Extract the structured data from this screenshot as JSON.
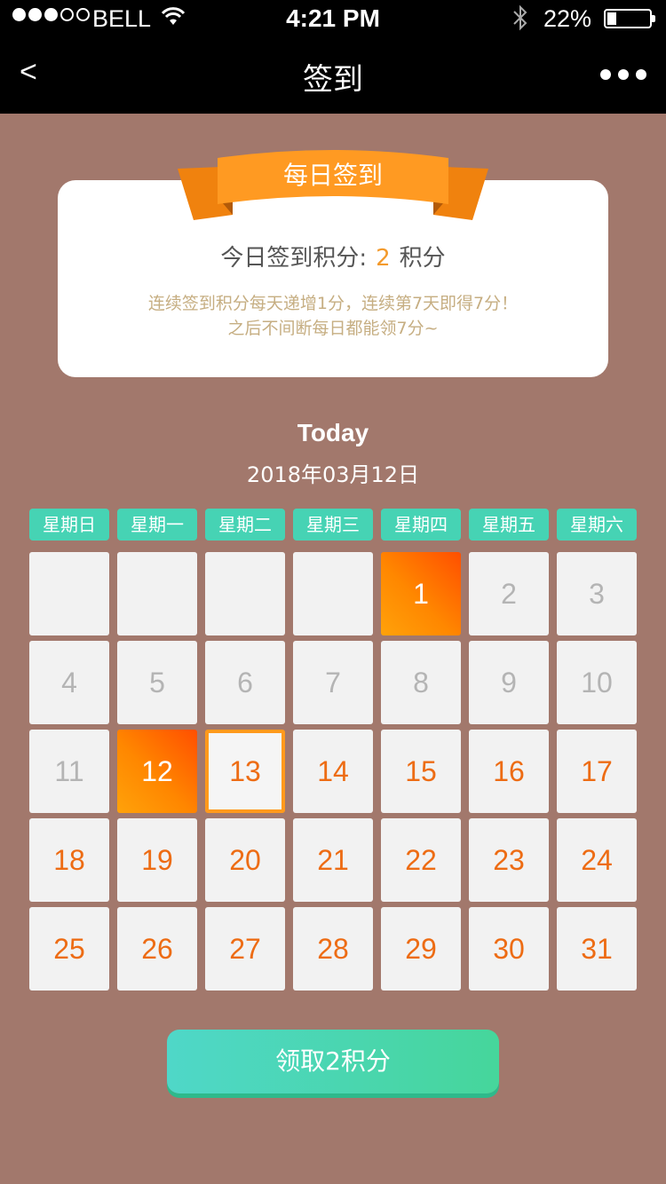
{
  "status_bar": {
    "carrier": "BELL",
    "time": "4:21 PM",
    "battery_percent": "22%",
    "battery_level": 0.22,
    "signal_bars_filled": 3,
    "signal_bars_total": 5
  },
  "nav": {
    "back_label": "<",
    "title": "签到"
  },
  "card": {
    "ribbon_label": "每日签到",
    "points_prefix": "今日签到积分:",
    "points_value": "2",
    "points_suffix": "积分",
    "desc_line1": "连续签到积分每天递增1分，连续第7天即得7分！",
    "desc_line2": "之后不间断每日都能领7分~"
  },
  "today_heading": "Today",
  "date": "2018年03月12日",
  "weekdays": [
    "星期日",
    "星期一",
    "星期二",
    "星期三",
    "星期四",
    "星期五",
    "星期六"
  ],
  "calendar": {
    "leading_blanks": 4,
    "days": [
      {
        "label": "1",
        "state": "signed"
      },
      {
        "label": "2",
        "state": "past"
      },
      {
        "label": "3",
        "state": "past"
      },
      {
        "label": "4",
        "state": "past"
      },
      {
        "label": "5",
        "state": "past"
      },
      {
        "label": "6",
        "state": "past"
      },
      {
        "label": "7",
        "state": "past"
      },
      {
        "label": "8",
        "state": "past"
      },
      {
        "label": "9",
        "state": "past"
      },
      {
        "label": "10",
        "state": "past"
      },
      {
        "label": "11",
        "state": "past"
      },
      {
        "label": "12",
        "state": "signed"
      },
      {
        "label": "13",
        "state": "today"
      },
      {
        "label": "14",
        "state": "future"
      },
      {
        "label": "15",
        "state": "future"
      },
      {
        "label": "16",
        "state": "future"
      },
      {
        "label": "17",
        "state": "future"
      },
      {
        "label": "18",
        "state": "future"
      },
      {
        "label": "19",
        "state": "future"
      },
      {
        "label": "20",
        "state": "future"
      },
      {
        "label": "21",
        "state": "future"
      },
      {
        "label": "22",
        "state": "future"
      },
      {
        "label": "23",
        "state": "future"
      },
      {
        "label": "24",
        "state": "future"
      },
      {
        "label": "25",
        "state": "future"
      },
      {
        "label": "26",
        "state": "future"
      },
      {
        "label": "27",
        "state": "future"
      },
      {
        "label": "28",
        "state": "future"
      },
      {
        "label": "29",
        "state": "future"
      },
      {
        "label": "30",
        "state": "future"
      },
      {
        "label": "31",
        "state": "future"
      }
    ]
  },
  "claim_button": "领取2积分",
  "colors": {
    "background": "#a2786c",
    "accent_orange": "#ff8a00",
    "teal": "#46d3b4",
    "future_text": "#ed6c14"
  }
}
